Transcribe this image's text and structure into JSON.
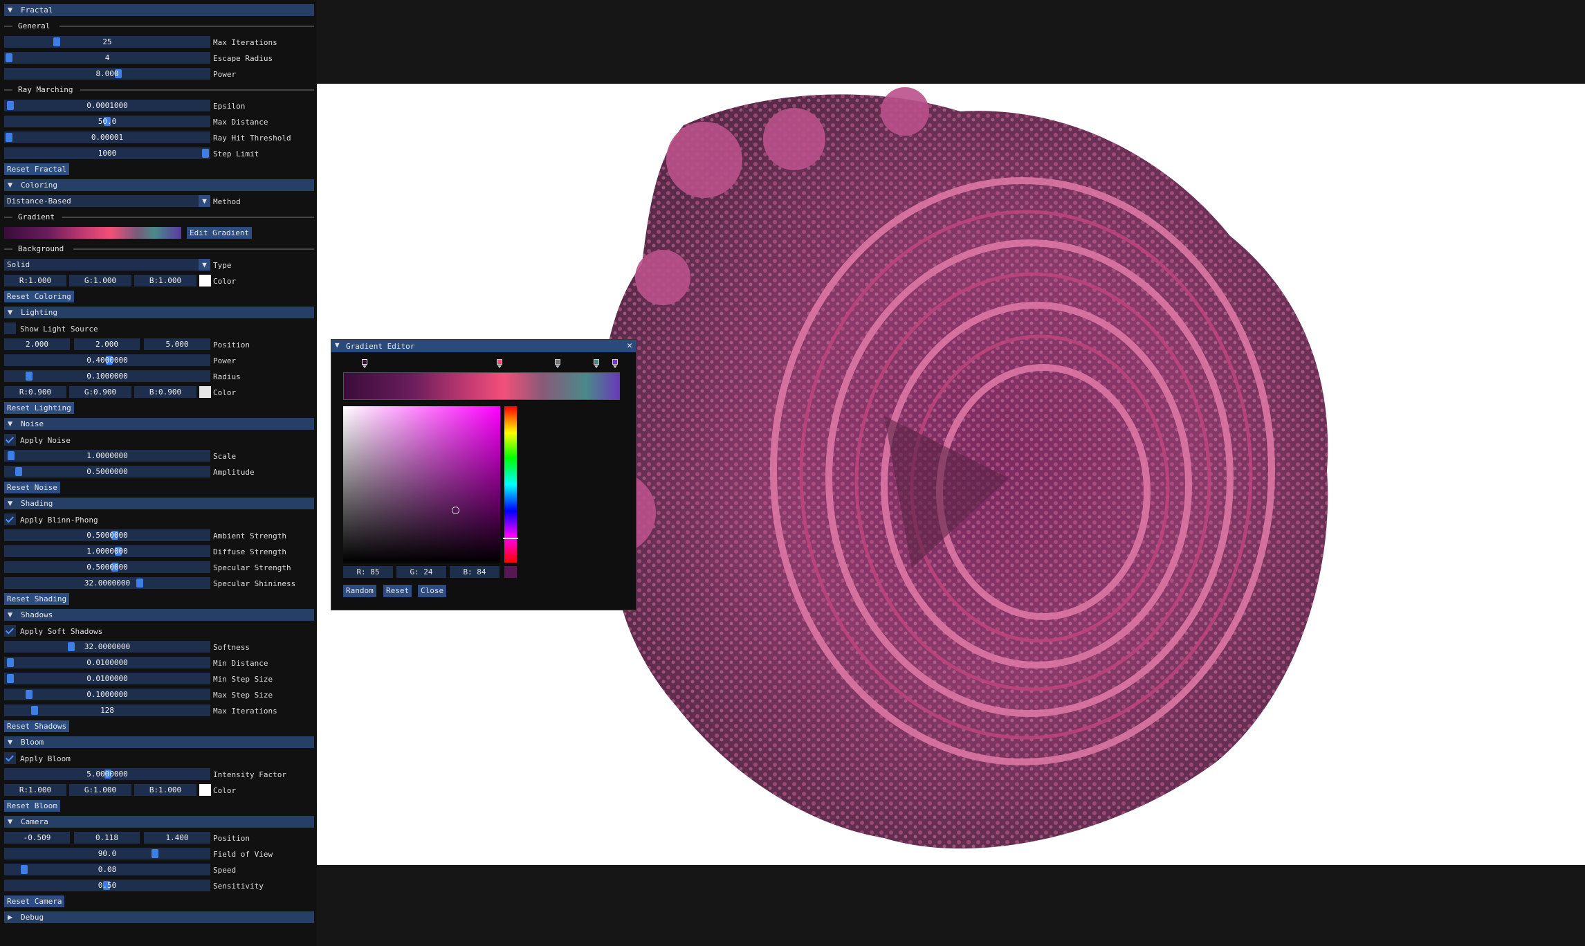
{
  "sidebar": {
    "fractal": {
      "header": "Fractal",
      "general": "General",
      "max_iterations": "25",
      "max_iterations_label": "Max Iterations",
      "escape_radius": "4",
      "escape_radius_label": "Escape Radius",
      "power": "8.000",
      "power_label": "Power",
      "ray_marching": "Ray Marching",
      "epsilon": "0.0001000",
      "epsilon_label": "Epsilon",
      "max_distance": "50.0",
      "max_distance_label": "Max Distance",
      "ray_hit": "0.00001",
      "ray_hit_label": "Ray Hit Threshold",
      "step_limit": "1000",
      "step_limit_label": "Step Limit",
      "reset": "Reset Fractal"
    },
    "coloring": {
      "header": "Coloring",
      "method": "Distance-Based",
      "method_label": "Method",
      "gradient": "Gradient",
      "edit_gradient": "Edit Gradient",
      "background": "Background",
      "type": "Solid",
      "type_label": "Type",
      "r": "R:1.000",
      "g": "G:1.000",
      "b": "B:1.000",
      "color_label": "Color",
      "reset": "Reset Coloring"
    },
    "lighting": {
      "header": "Lighting",
      "show_light": "Show Light Source",
      "px": "2.000",
      "py": "2.000",
      "pz": "5.000",
      "position_label": "Position",
      "power": "0.4000000",
      "power_label": "Power",
      "radius": "0.1000000",
      "radius_label": "Radius",
      "r": "R:0.900",
      "g": "G:0.900",
      "b": "B:0.900",
      "color_label": "Color",
      "reset": "Reset Lighting"
    },
    "noise": {
      "header": "Noise",
      "apply": "Apply Noise",
      "scale": "1.0000000",
      "scale_label": "Scale",
      "amplitude": "0.5000000",
      "amplitude_label": "Amplitude",
      "reset": "Reset Noise"
    },
    "shading": {
      "header": "Shading",
      "apply": "Apply Blinn-Phong",
      "ambient": "0.5000000",
      "ambient_label": "Ambient Strength",
      "diffuse": "1.0000000",
      "diffuse_label": "Diffuse Strength",
      "specular": "0.5000000",
      "specular_label": "Specular Strength",
      "shininess": "32.0000000",
      "shininess_label": "Specular Shininess",
      "reset": "Reset Shading"
    },
    "shadows": {
      "header": "Shadows",
      "apply": "Apply Soft Shadows",
      "softness": "32.0000000",
      "softness_label": "Softness",
      "min_distance": "0.0100000",
      "min_distance_label": "Min Distance",
      "min_step": "0.0100000",
      "min_step_label": "Min Step Size",
      "max_step": "0.1000000",
      "max_step_label": "Max Step Size",
      "max_iter": "128",
      "max_iter_label": "Max Iterations",
      "reset": "Reset Shadows"
    },
    "bloom": {
      "header": "Bloom",
      "apply": "Apply Bloom",
      "intensity": "5.0000000",
      "intensity_label": "Intensity Factor",
      "r": "R:1.000",
      "g": "G:1.000",
      "b": "B:1.000",
      "color_label": "Color",
      "reset": "Reset Bloom"
    },
    "camera": {
      "header": "Camera",
      "px": "-0.509",
      "py": "0.118",
      "pz": "1.400",
      "position_label": "Position",
      "fov": "90.0",
      "fov_label": "Field of View",
      "speed": "0.08",
      "speed_label": "Speed",
      "sensitivity": "0.50",
      "sensitivity_label": "Sensitivity",
      "reset": "Reset Camera"
    },
    "debug": {
      "header": "Debug"
    }
  },
  "gradient_editor": {
    "title": "Gradient Editor",
    "r": "R: 85",
    "g": "G: 24",
    "b": "B: 84",
    "random": "Random",
    "reset": "Reset",
    "close": "Close",
    "selected_color": "#551854"
  },
  "colors": {
    "header": "#263f66",
    "button": "#2d4d80",
    "frame": "#1d2f4d",
    "grab": "#3d7fe6"
  }
}
